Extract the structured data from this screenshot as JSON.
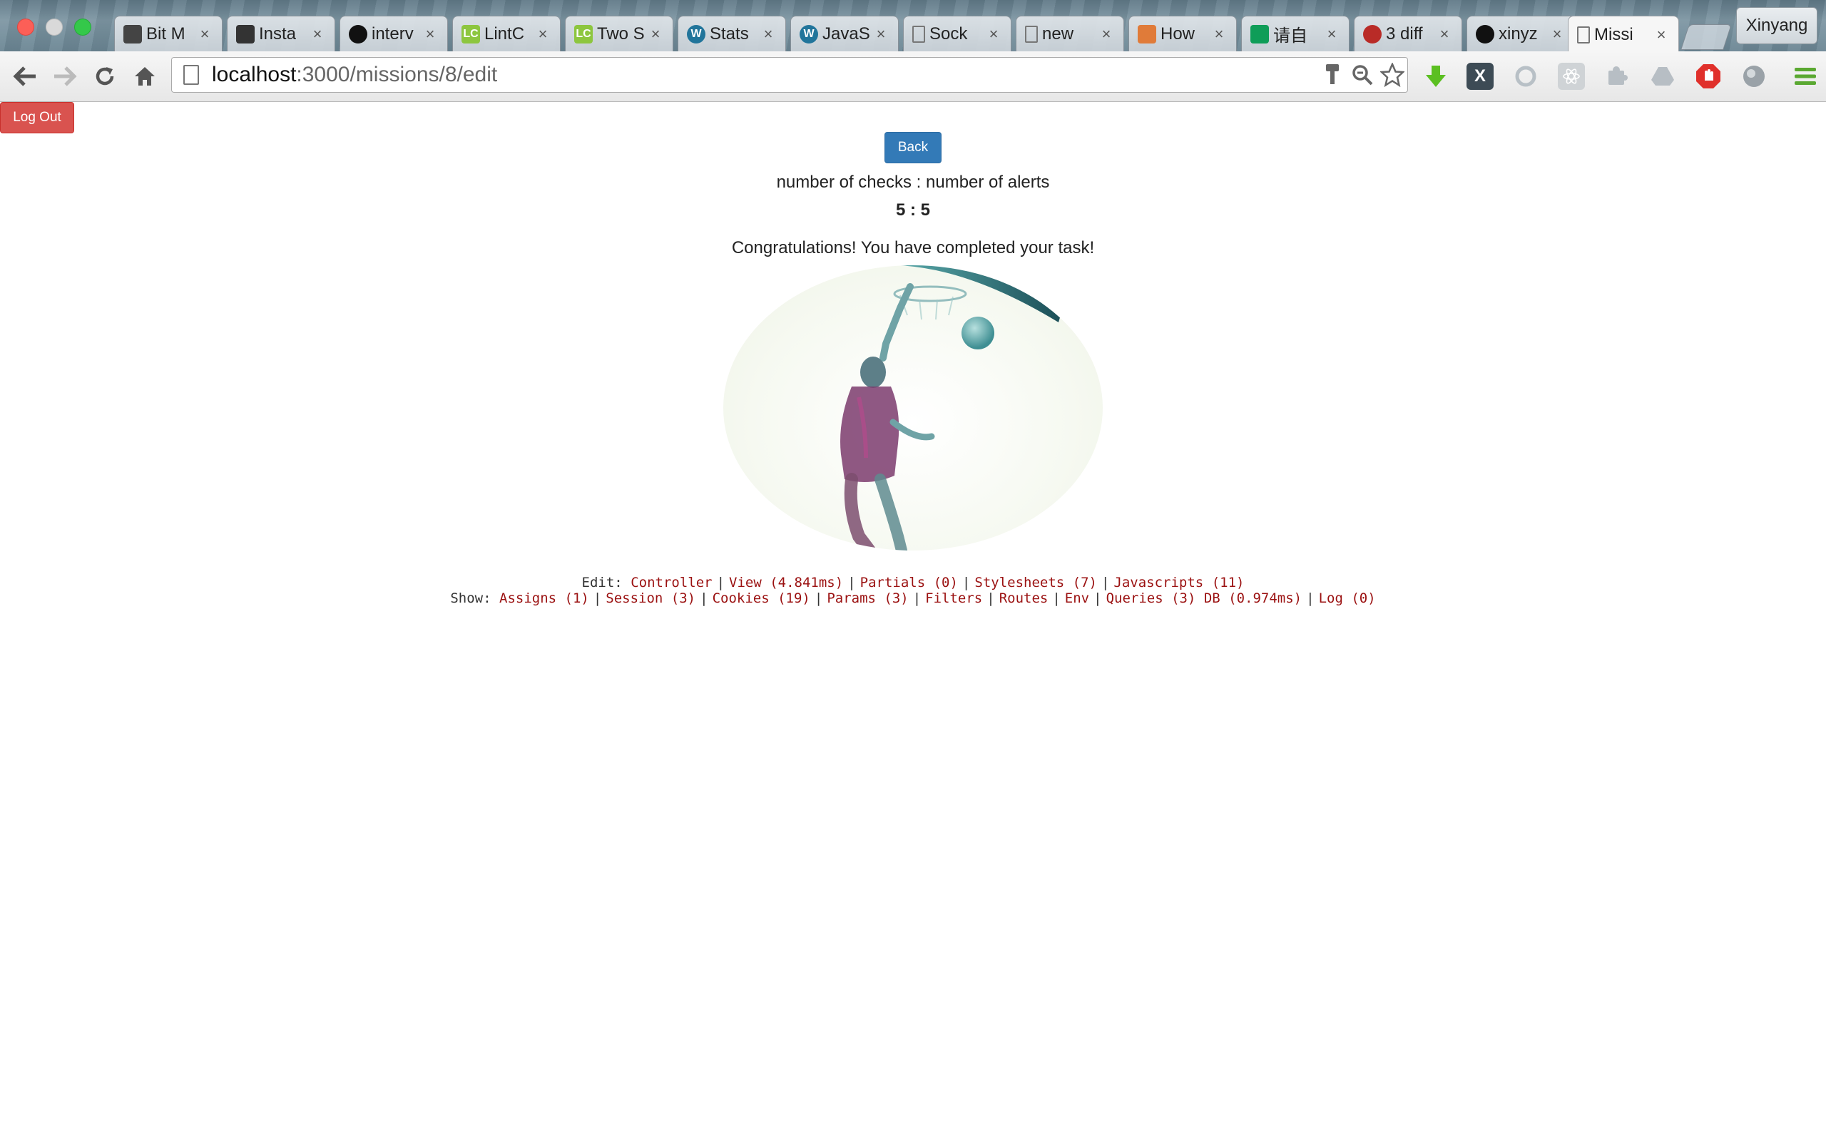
{
  "browser": {
    "tabs": [
      {
        "title": "Bit M",
        "icon": "book-icon",
        "color": "#444444"
      },
      {
        "title": "Insta",
        "icon": "columns-icon",
        "color": "#333333"
      },
      {
        "title": "interv",
        "icon": "github-icon",
        "color": "#111111"
      },
      {
        "title": "LintC",
        "icon": "lintcode-icon",
        "color": "#8dc63f",
        "glyph": "LC"
      },
      {
        "title": "Two S",
        "icon": "lintcode-icon",
        "color": "#8dc63f",
        "glyph": "LC"
      },
      {
        "title": "Stats",
        "icon": "wordpress-icon",
        "color": "#21759b",
        "glyph": "W"
      },
      {
        "title": "JavaS",
        "icon": "wordpress-icon",
        "color": "#21759b",
        "glyph": "W"
      },
      {
        "title": "Sock",
        "icon": "page-icon",
        "color": "#777777"
      },
      {
        "title": "new",
        "icon": "page-icon",
        "color": "#777777"
      },
      {
        "title": "How",
        "icon": "pencil-icon",
        "color": "#e07b39"
      },
      {
        "title": "请自",
        "icon": "sheets-icon",
        "color": "#0f9d58"
      },
      {
        "title": "3 diff",
        "icon": "quora-icon",
        "color": "#b92b27"
      },
      {
        "title": "xinyz",
        "icon": "github-icon",
        "color": "#111111"
      },
      {
        "title": "Missi",
        "icon": "page-icon",
        "color": "#777777",
        "active": true
      }
    ],
    "profile": "Xinyang",
    "url_host": "localhost",
    "url_path": ":3000/missions/8/edit"
  },
  "page": {
    "logout_label": "Log Out",
    "back_label": "Back",
    "checks_label": "number of checks : number of alerts",
    "checks_value": "5 : 5",
    "congrats": "Congratulations! You have completed your task!"
  },
  "debug": {
    "edit_prefix": "Edit:",
    "edit_links": [
      "Controller",
      "View (4.841ms)",
      "Partials (0)",
      "Stylesheets (7)",
      "Javascripts (11)"
    ],
    "show_prefix": "Show:",
    "show_links": [
      "Assigns (1)",
      "Session (3)",
      "Cookies (19)",
      "Params (3)",
      "Filters",
      "Routes",
      "Env",
      "Queries (3) DB (0.974ms)",
      "Log (0)"
    ]
  }
}
